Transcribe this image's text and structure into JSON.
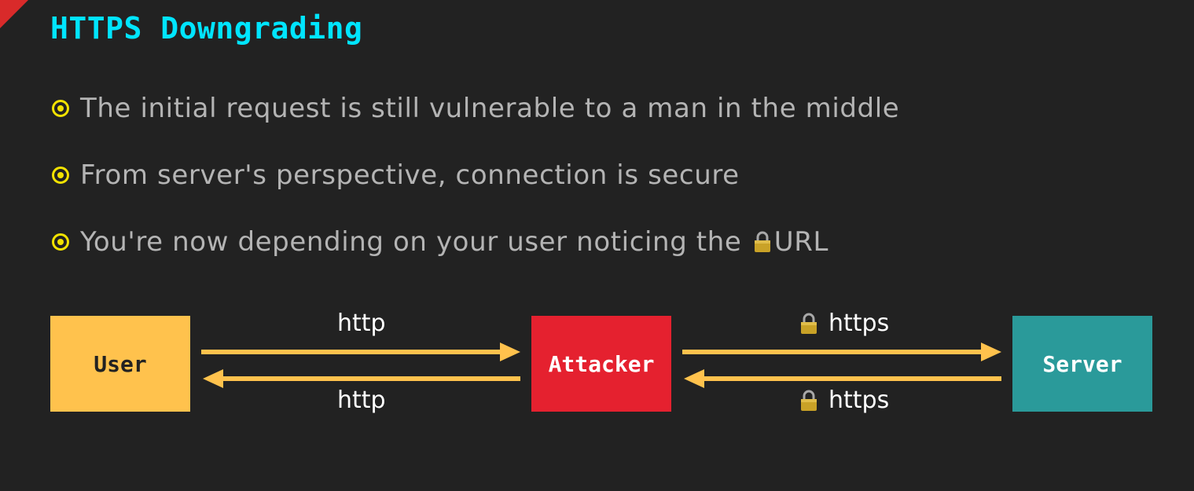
{
  "slide": {
    "title": "HTTPS Downgrading",
    "bullets": [
      {
        "text": "The initial request is still vulnerable to a man in the middle"
      },
      {
        "text": "From server's perspective, connection is secure"
      },
      {
        "text_before": "You're now depending on your user noticing the ",
        "icon": "lock-icon",
        "text_after": "URL"
      }
    ]
  },
  "diagram": {
    "nodes": [
      {
        "id": "user",
        "label": "User",
        "color": "#ffc24d"
      },
      {
        "id": "attacker",
        "label": "Attacker",
        "color": "#e5212f"
      },
      {
        "id": "server",
        "label": "Server",
        "color": "#2a9a9a"
      }
    ],
    "edges": [
      {
        "from": "user",
        "to": "attacker",
        "label": "http",
        "secure": false
      },
      {
        "from": "attacker",
        "to": "user",
        "label": "http",
        "secure": false
      },
      {
        "from": "attacker",
        "to": "server",
        "label": "https",
        "secure": true
      },
      {
        "from": "server",
        "to": "attacker",
        "label": "https",
        "secure": true
      }
    ],
    "arrow_color": "#ffc24d"
  },
  "colors": {
    "background": "#222222",
    "title": "#00e5ff",
    "bullet_text": "#b4b4b4",
    "bullet_marker": "#f2e200",
    "ribbon": "#d92a2a"
  }
}
